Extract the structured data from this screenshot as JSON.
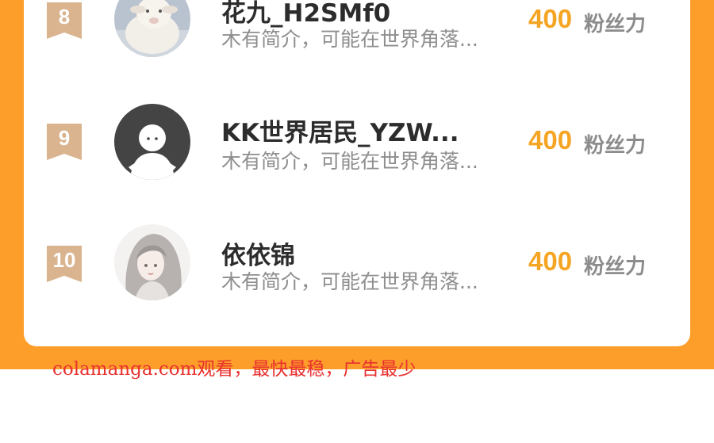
{
  "ranking": {
    "items": [
      {
        "rank": "8",
        "name": "花九_H2SMf0",
        "bio": "木有简介，可能在世界角落...",
        "followers": "400",
        "unit": "粉丝力",
        "avatar": "sheep-avatar-icon"
      },
      {
        "rank": "9",
        "name": "KK世界居民_YZW...",
        "bio": "木有简介，可能在世界角落...",
        "followers": "400",
        "unit": "粉丝力",
        "avatar": "default-user-avatar-icon"
      },
      {
        "rank": "10",
        "name": "依依锦",
        "bio": "木有简介，可能在世界角落...",
        "followers": "400",
        "unit": "粉丝力",
        "avatar": "anime-girl-avatar-icon"
      }
    ]
  },
  "watermark": "colamanga.com观看，最快最稳，广告最少",
  "colors": {
    "background": "#fd9d2a",
    "count": "#f5a524",
    "badge": "#d9b48f",
    "watermark": "#e8302f"
  }
}
